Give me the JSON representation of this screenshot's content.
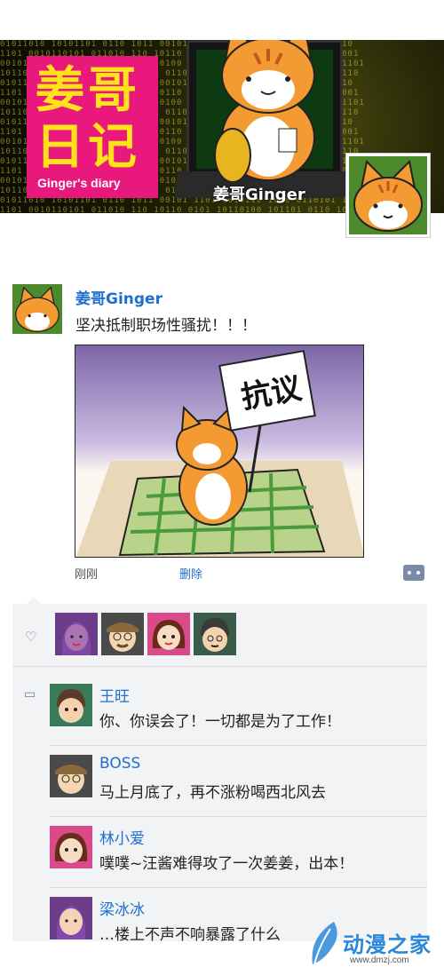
{
  "banner": {
    "logo_line1": "姜哥",
    "logo_line2": "日记",
    "logo_subtitle": "Ginger's diary",
    "name": "姜哥Ginger",
    "colors": {
      "logo_bg": "#e8187c",
      "logo_text": "#ffe31a"
    }
  },
  "post": {
    "author": "姜哥Ginger",
    "text": "坚决抵制职场性骚扰！！！",
    "image_sign_text": "抗议",
    "time": "刚刚",
    "delete_label": "删除"
  },
  "likes": {
    "avatars": [
      "梁冰冰",
      "BOSS",
      "林小爱",
      "王旺"
    ]
  },
  "comments": [
    {
      "name": "王旺",
      "text": "你、你误会了！一切都是为了工作！"
    },
    {
      "name": "BOSS",
      "text": "马上月底了，再不涨粉喝西北风去"
    },
    {
      "name": "林小爱",
      "text": "噗噗~汪酱难得攻了一次姜姜，出本！"
    },
    {
      "name": "梁冰冰",
      "text": "…楼上不声不响暴露了什么"
    }
  ],
  "watermark": {
    "main": "动漫之家",
    "sub": "www.dmzj.com"
  },
  "colors": {
    "link_blue": "#1f6fd1",
    "panel_bg": "#f2f3f5"
  }
}
